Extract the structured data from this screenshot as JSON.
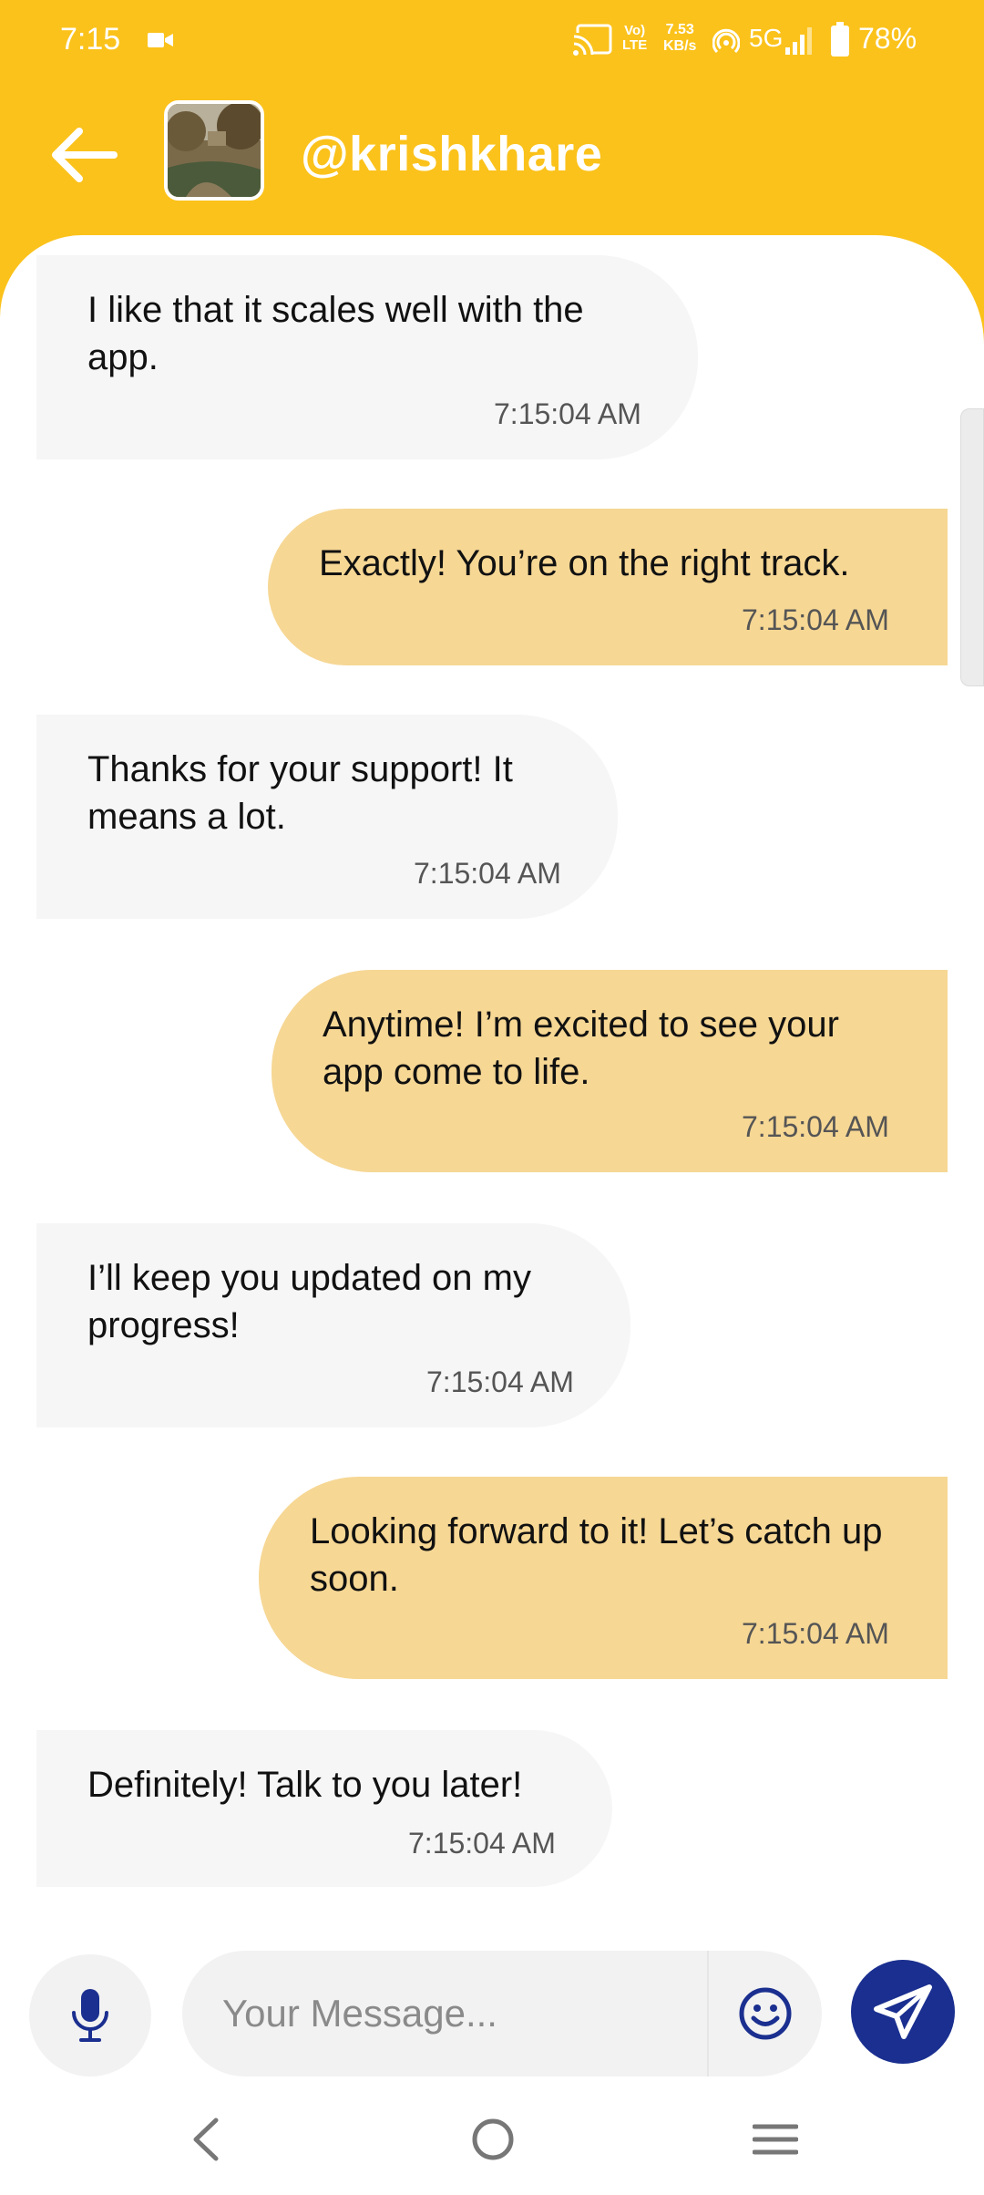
{
  "status_bar": {
    "time": "7:15",
    "volte_top": "Vo)",
    "volte_bottom": "LTE",
    "speed_value": "7.53",
    "speed_unit": "KB/s",
    "network": "5G",
    "battery": "78%"
  },
  "header": {
    "username": "@krishkhare",
    "icons": {
      "back": "arrow-left-icon",
      "avatar": "profile-photo"
    }
  },
  "messages": [
    {
      "side": "received",
      "text": "I like that it scales well with the app.",
      "time": "7:15:04 AM"
    },
    {
      "side": "sent",
      "text": "Exactly! You’re on the right track.",
      "time": "7:15:04 AM"
    },
    {
      "side": "received",
      "text": "Thanks for your support! It means a lot.",
      "time": "7:15:04 AM"
    },
    {
      "side": "sent",
      "text": "Anytime! I’m excited to see your app come to life.",
      "time": "7:15:04 AM"
    },
    {
      "side": "received",
      "text": "I’ll keep you updated on my progress!",
      "time": "7:15:04 AM"
    },
    {
      "side": "sent",
      "text": "Looking forward to it! Let’s catch up soon.",
      "time": "7:15:04 AM"
    },
    {
      "side": "received",
      "text": "Definitely! Talk to you later!",
      "time": "7:15:04 AM"
    }
  ],
  "composer": {
    "placeholder": "Your Message...",
    "value": "",
    "icons": {
      "mic": "microphone-icon",
      "emoji": "emoji-icon",
      "send": "send-icon"
    }
  },
  "nav_bar": {
    "icons": [
      "back-icon",
      "home-icon",
      "recents-icon"
    ]
  },
  "colors": {
    "accent": "#FBC21B",
    "sent_bubble": "#F6D794",
    "received_bubble": "#F6F6F6",
    "send_button": "#1A2F8F"
  }
}
